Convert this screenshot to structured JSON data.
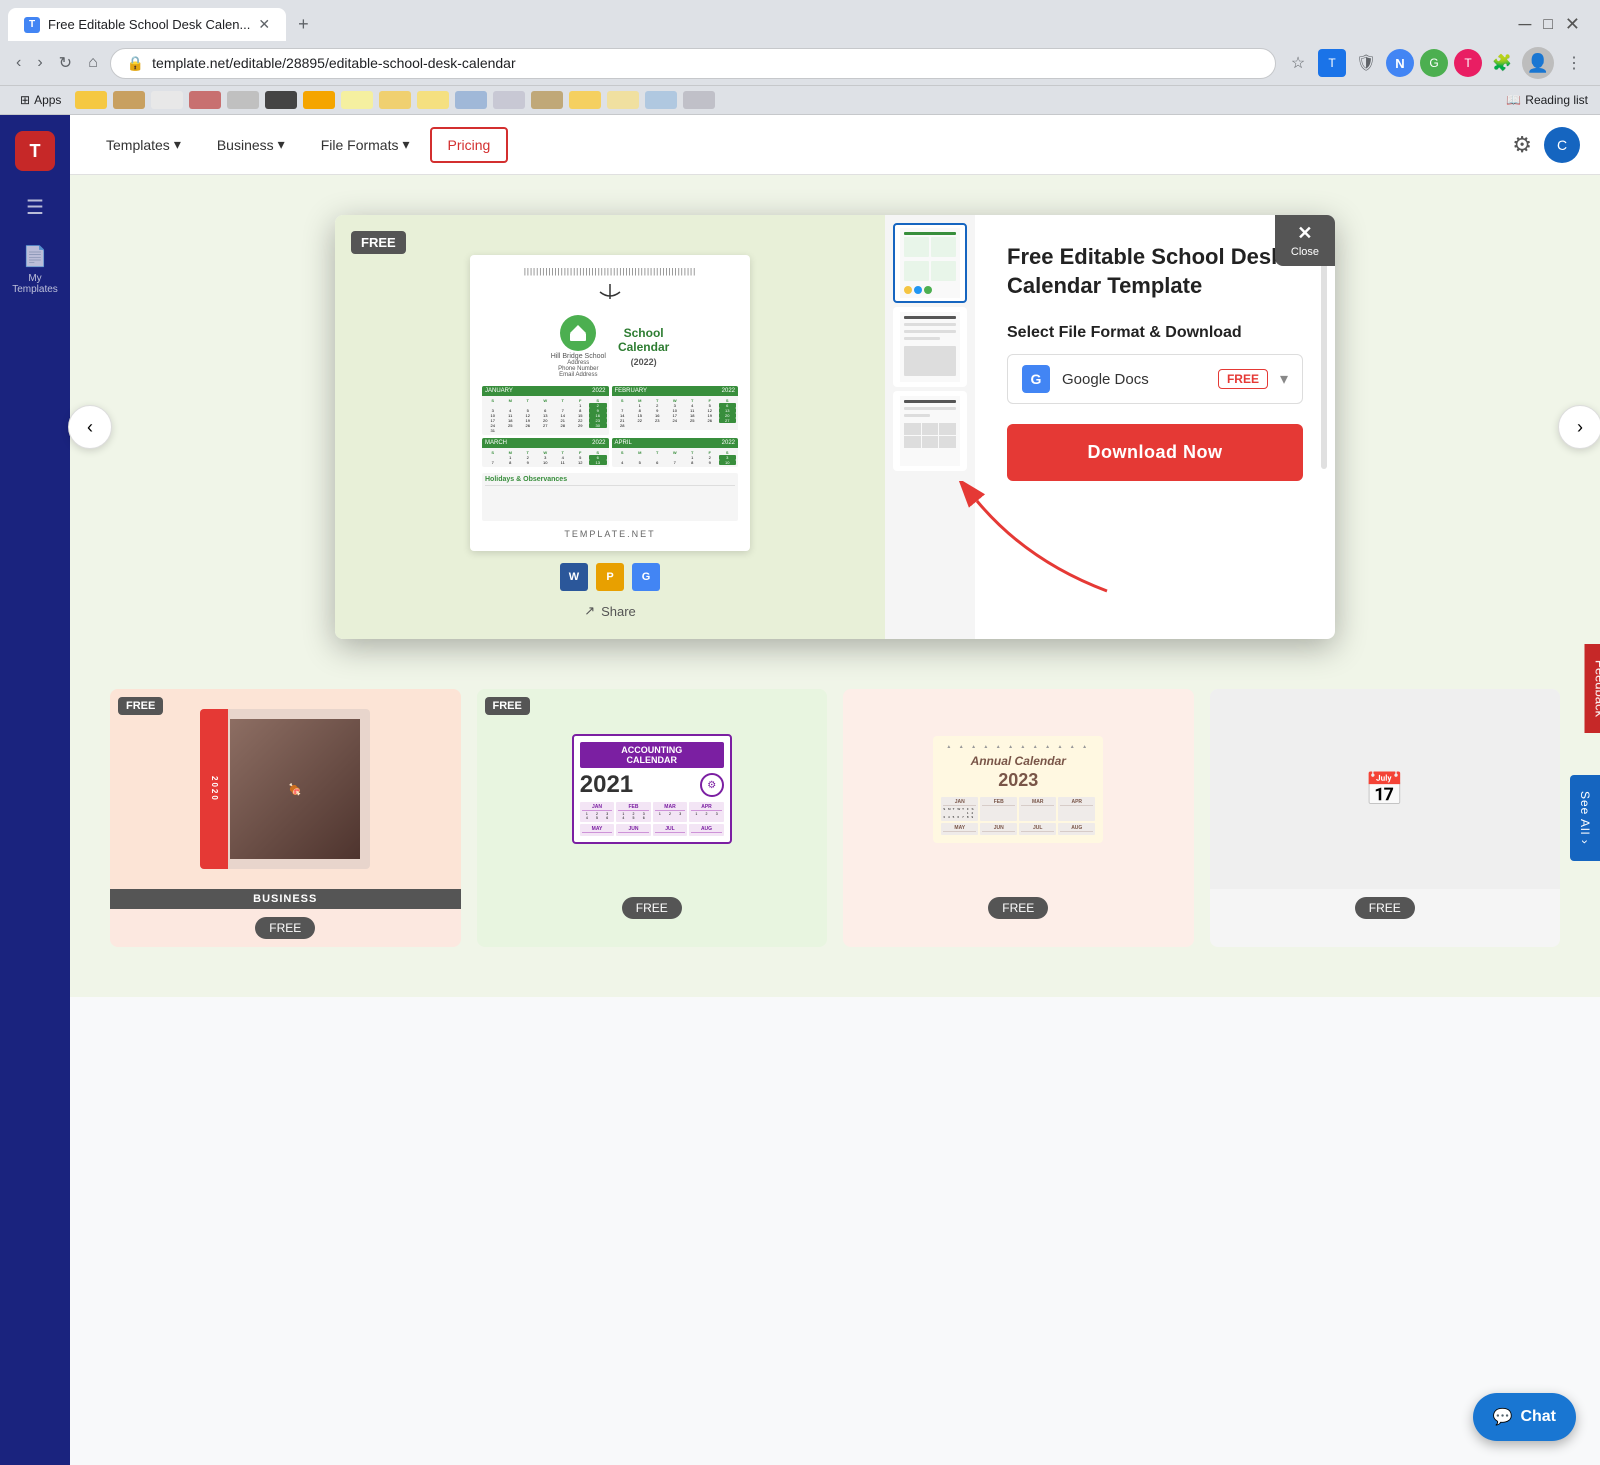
{
  "browser": {
    "tab_title": "Free Editable School Desk Calen...",
    "url": "template.net/editable/28895/editable-school-desk-calendar",
    "new_tab_label": "+",
    "apps_label": "Apps",
    "reading_list_label": "Reading list",
    "bookmarks": [
      {
        "color": "#f5c842"
      },
      {
        "color": "#c8a060"
      },
      {
        "color": "#e0e0e0"
      },
      {
        "color": "#c87070"
      },
      {
        "color": "#d4d4d4"
      },
      {
        "color": "#f5a500"
      },
      {
        "color": "#f5f0a0"
      },
      {
        "color": "#f0d070"
      },
      {
        "color": "#f5e080"
      },
      {
        "color": "#a0b8d8"
      },
      {
        "color": "#c8c8d4"
      },
      {
        "color": "#c0a878"
      },
      {
        "color": "#555555"
      },
      {
        "color": "#f5d060"
      },
      {
        "color": "#f0e0a0"
      },
      {
        "color": "#b0c8e0"
      },
      {
        "color": "#c0c0c8"
      }
    ]
  },
  "sidebar": {
    "logo_letter": "T",
    "items": [
      {
        "label": "",
        "icon": "☰"
      },
      {
        "label": "My\nTemplates",
        "icon": "📄"
      }
    ]
  },
  "navbar": {
    "items": [
      {
        "label": "Templates",
        "has_arrow": true
      },
      {
        "label": "Business",
        "has_arrow": true
      },
      {
        "label": "File Formats",
        "has_arrow": true
      },
      {
        "label": "Pricing",
        "is_active": true
      }
    ]
  },
  "modal": {
    "close_label": "Close",
    "close_x": "✕",
    "prev_arrow": "‹",
    "next_arrow": "›",
    "product_title": "Free Editable School Desk Calendar Template",
    "free_badge": "FREE",
    "select_format_label": "Select File Format & Download",
    "format_name": "Google Docs",
    "format_free_badge": "FREE",
    "download_label": "Download Now",
    "share_label": "Share",
    "template_watermark": "TEMPLATE.NET",
    "format_icons": [
      {
        "letter": "W",
        "color": "#2b579a",
        "label": "Word"
      },
      {
        "letter": "P",
        "color": "#e8a000",
        "label": "Pages"
      },
      {
        "letter": "G",
        "color": "#4285f4",
        "label": "Google Docs"
      }
    ]
  },
  "thumbnails": [
    {
      "id": 1,
      "active": true
    },
    {
      "id": 2,
      "active": false
    },
    {
      "id": 3,
      "active": false
    }
  ],
  "suggested_templates": [
    {
      "badge": "FREE",
      "bg_class": "peach-bg",
      "type": "business_calendar",
      "bottom_badge": "FREE"
    },
    {
      "badge": "FREE",
      "bg_class": "accounting-card",
      "type": "accounting_calendar",
      "bottom_badge": "FREE"
    },
    {
      "badge": null,
      "bg_class": "salmon-bg",
      "type": "annual_calendar",
      "bottom_badge": "FREE"
    },
    {
      "badge": null,
      "bg_class": "",
      "type": "placeholder",
      "bottom_badge": "FREE"
    }
  ],
  "chat_button": {
    "label": "Chat",
    "icon": "💬"
  },
  "feedback_label": "Feedback"
}
